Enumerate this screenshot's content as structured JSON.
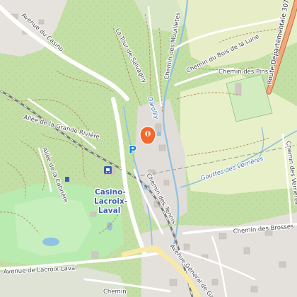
{
  "colors": {
    "forest": "#c4dfa6",
    "forest_dark": "#b6d798",
    "meadow": "#e9f1cf",
    "park": "#b9eab0",
    "residential": "#e4e1dc",
    "water": "#8fc2e3",
    "major_road": "#f2a77e",
    "marker": "#f2692c"
  },
  "places": {
    "station_line1": "Casino-",
    "station_line2": "Lacroix-",
    "station_line3": "Laval"
  },
  "streets": {
    "avenue_du_casino": "Avenue du Casino",
    "la_tour_de_salvagny": "La Tour-de-Salvagny",
    "chemin_des_mouilletes": "Chemin des Mouilletes",
    "chemin_du_bois_de_la_lune": "Chemin du Bois de la Lune",
    "route_departementale": "Route Départementale 307",
    "chemin_des_pins": "Chemin des Pins",
    "allee_grande_riviere": "Allée de la Grande Rivière",
    "allee_de_la_cabriere": "Allée de la Cabrière",
    "chemin_des_tennis": "Chemin des Tennis",
    "chemin_des_brosses": "Chemin des Brosses",
    "chemin_des_verrieres": "Chemin des Verrières",
    "avenue_general": "Avenue Général de Ga",
    "avenue_lacroix_laval": "Avenue de Lacroix-Laval",
    "chemin_bottom": "Chemin",
    "dardilly": "Dardilly"
  },
  "water": {
    "gouttes_verrieres": "Gouttes des Verrières"
  },
  "icons": {
    "parking": "P",
    "location_marker": "location-pin-icon",
    "station": "train-station-icon"
  }
}
